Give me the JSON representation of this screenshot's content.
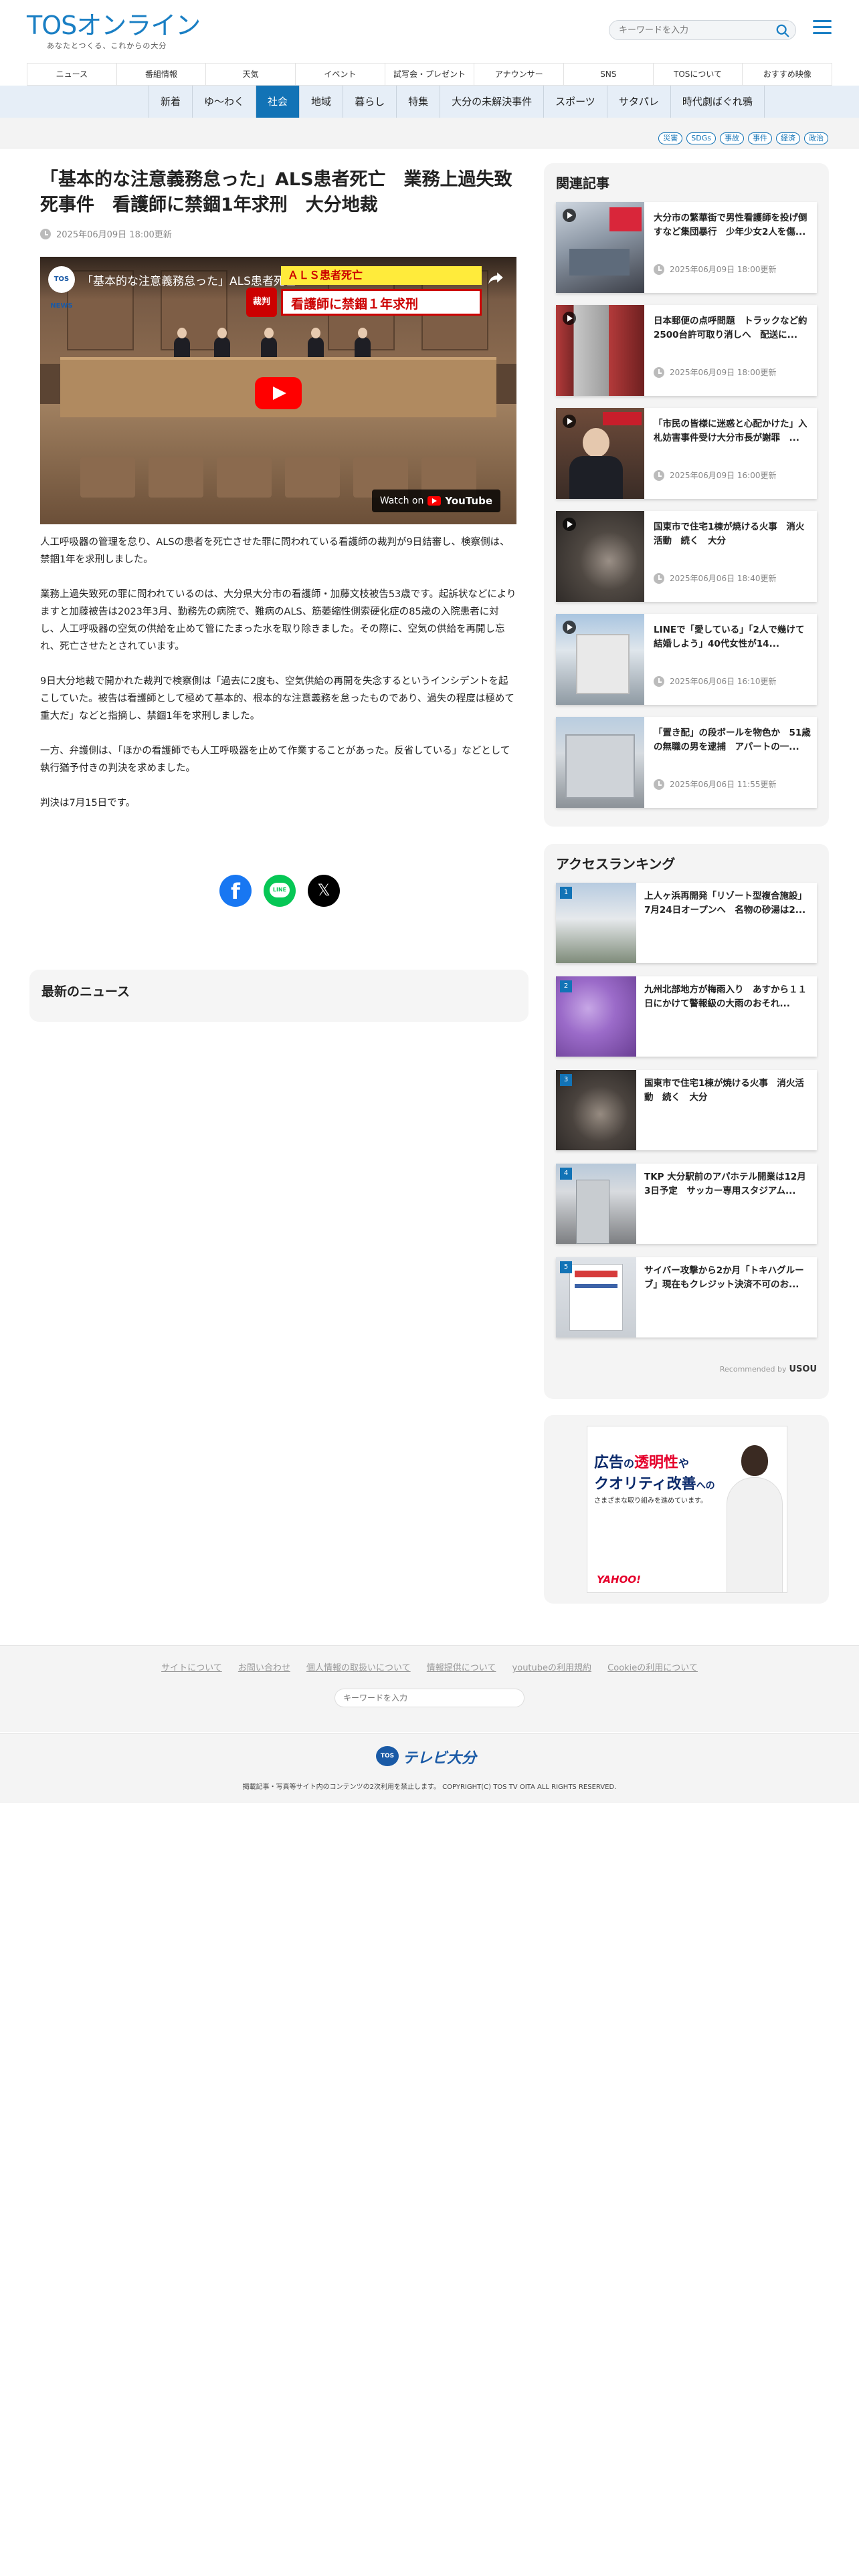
{
  "header": {
    "logo_main": "TOSオンライン",
    "logo_sub": "あなたとつくる、これからの大分",
    "search_placeholder": "キーワードを入力"
  },
  "global_nav": [
    "ニュース",
    "番組情報",
    "天気",
    "イベント",
    "試写会・プレゼント",
    "アナウンサー",
    "SNS",
    "TOSについて",
    "おすすめ映像"
  ],
  "category_nav": {
    "items": [
      "新着",
      "ゆ〜わく",
      "社会",
      "地域",
      "暮らし",
      "特集",
      "大分の未解決事件",
      "スポーツ",
      "サタパレ",
      "時代劇ばぐれ鴉"
    ],
    "active": "社会"
  },
  "tags": [
    "災害",
    "SDGs",
    "事故",
    "事件",
    "経済",
    "政治"
  ],
  "article": {
    "title": "「基本的な注意義務怠った」ALS患者死亡　業務上過失致死事件　看護師に禁錮1年求刑　大分地裁",
    "date": "2025年06月09日 18:00更新",
    "video": {
      "channel": "TOS NEWS",
      "title": "「基本的な注意義務怠った」ALS患者死亡",
      "caption_tag": "裁判",
      "caption_line1": "ＡＬＳ患者死亡",
      "caption_line2": "看護師に禁錮１年求刑",
      "watch_on": "Watch on",
      "youtube": "YouTube"
    },
    "paragraphs": [
      "人工呼吸器の管理を怠り、ALSの患者を死亡させた罪に問われている看護師の裁判が9日結審し、検察側は、禁錮1年を求刑しました。",
      "業務上過失致死の罪に問われているのは、大分県大分市の看護師・加藤文枝被告53歳です。起訴状などによりますと加藤被告は2023年3月、勤務先の病院で、難病のALS、筋萎縮性側索硬化症の85歳の入院患者に対し、人工呼吸器の空気の供給を止めて管にたまった水を取り除きました。その際に、空気の供給を再開し忘れ、死亡させたとされています。",
      "9日大分地裁で開かれた裁判で検察側は「過去に2度も、空気供給の再開を失念するというインシデントを起こしていた。被告は看護師として極めて基本的、根本的な注意義務を怠ったものであり、過失の程度は極めて重大だ」などと指摘し、禁錮1年を求刑しました。",
      "一方、弁護側は、「ほかの看護師でも人工呼吸器を止めて作業することがあった。反省している」などとして執行猶予付きの判決を求めました。",
      "判決は7月15日です。"
    ],
    "share": {
      "facebook": "facebook",
      "line": "LINE",
      "x": "X"
    }
  },
  "latest_news": {
    "title": "最新のニュース"
  },
  "related": {
    "title": "関連記事",
    "items": [
      {
        "title": "大分市の繁華街で男性看護師を投げ倒すなど集団暴行　少年少女2人を傷...",
        "date": "2025年06月09日 18:00更新"
      },
      {
        "title": "日本郵便の点呼問題　トラックなど約2500台許可取り消しへ　配送に...",
        "date": "2025年06月09日 18:00更新"
      },
      {
        "title": "「市民の皆様に迷惑と心配かけた」入札妨害事件受け大分市長が謝罪　...",
        "date": "2025年06月09日 16:00更新"
      },
      {
        "title": "国東市で住宅1棟が焼ける火事　消火活動　続く　大分",
        "date": "2025年06月06日 18:40更新"
      },
      {
        "title": "LINEで「愛している」「2人で幾けて結婚しよう」40代女性が14...",
        "date": "2025年06月06日 16:10更新"
      },
      {
        "title": "「置き配」の段ボールを物色か　51歳の無職の男を逮捕　アパートの一...",
        "date": "2025年06月06日 11:55更新"
      }
    ]
  },
  "ranking": {
    "title": "アクセスランキング",
    "items": [
      {
        "rank": "1",
        "title": "上人ヶ浜再開発「リゾート型複合施設」7月24日オープンへ　名物の砂湯は2..."
      },
      {
        "rank": "2",
        "title": "九州北部地方が梅雨入り　あすから１１日にかけて警報級の大雨のおそれ..."
      },
      {
        "rank": "3",
        "title": "国東市で住宅1棟が焼ける火事　消火活動　続く　大分"
      },
      {
        "rank": "4",
        "title": "TKP 大分駅前のアパホテル開業は12月3日予定　サッカー専用スタジアム..."
      },
      {
        "rank": "5",
        "title": "サイバー攻撃から2か月「トキハグルーブ」現在もクレジット決済不可のお..."
      }
    ],
    "recommended_by": "Recommended by",
    "recommended_brand": "USOU"
  },
  "ad": {
    "line1_a": "広告",
    "line1_b": "の",
    "line1_c": "透明性",
    "line1_d": "や",
    "line2_a": "クオリティ改善",
    "line2_b": "への",
    "line3": "さまざまな取り組みを進めています。",
    "brand": "YAHOO!"
  },
  "footer": {
    "links": [
      "サイトについて",
      "お問い合わせ",
      "個人情報の取扱いについて",
      "情報提供について",
      "youtubeの利用規約",
      "Cookieの利用について"
    ],
    "search_placeholder": "キーワードを入力",
    "logo_badge": "TOS",
    "logo_name": "テレビ大分",
    "copyright": "掲載記事・写真等サイト内のコンテンツの2次利用を禁止します。 COPYRIGHT(C) TOS TV OITA ALL RIGHTS RESERVED."
  },
  "colors": {
    "brand": "#1a7fc4",
    "active_tab": "#1273b6",
    "facebook": "#1877f2",
    "line": "#06c755"
  }
}
